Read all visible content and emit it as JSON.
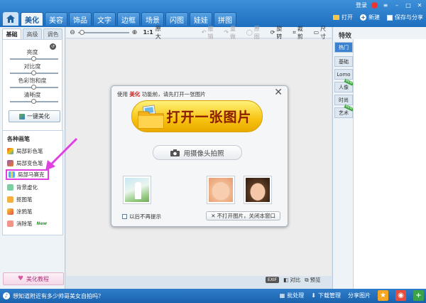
{
  "topbar": {
    "tabs": [
      "美化",
      "美容",
      "饰品",
      "文字",
      "边框",
      "场景",
      "闪图",
      "娃娃",
      "拼图"
    ],
    "active_tab": "美化",
    "login": "登录",
    "open": "打开",
    "new": "新建",
    "save_share": "保存与分享"
  },
  "left": {
    "subtabs": [
      "基础",
      "高级",
      "调色"
    ],
    "sliders": [
      "亮度",
      "对比度",
      "色彩饱和度",
      "清晰度"
    ],
    "one_key": "一键美化",
    "pens_title": "各种画笔",
    "pens": [
      "局部彩色笔",
      "局部变色笔",
      "局部马赛克",
      "背景虚化",
      "抠图笔",
      "涂鸦笔",
      "消除笔"
    ],
    "new_badge": "New",
    "tutorial": "美化教程"
  },
  "toolbar": {
    "ratio": "1:1",
    "original": "原大",
    "undo": "撤销",
    "redo": "重做",
    "original_img": "原图",
    "rotate": "旋转",
    "crop": "裁剪",
    "size": "尺寸"
  },
  "canvas": {
    "exif": "EXIF",
    "compare": "对比",
    "preview": "预览"
  },
  "dialog": {
    "title_prefix": "使用",
    "title_highlight": "美化",
    "title_suffix": "功能前，请先打开一张图片",
    "open_btn": "打开一张图片",
    "camera_btn": "用摄像头拍照",
    "dont_show": "以后不再提示",
    "no_open": "不打开图片，关闭本窗口"
  },
  "right": {
    "title": "特效",
    "tabs": [
      "热门",
      "基础",
      "Lomo",
      "人像",
      "时尚",
      "艺术"
    ],
    "new_marks": [
      "人像",
      "艺术"
    ],
    "new_mark_text": "NEW"
  },
  "status": {
    "message": "想知道附近有多少帅哥美女自拍吗？",
    "batch": "批处理",
    "download": "下载管理",
    "share": "分享图片"
  },
  "colors": {
    "blue": "#1e6fbf",
    "highlight": "#e040e0",
    "button_yellow": "#f7c310",
    "title_red": "#cc1a1a"
  }
}
